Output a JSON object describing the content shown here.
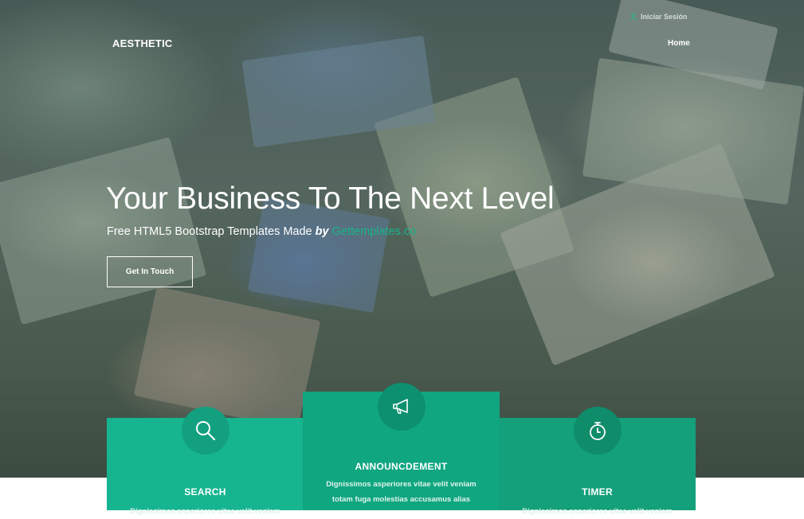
{
  "topbar": {
    "login_label": "Iniciar Sesión"
  },
  "navbar": {
    "brand": "AESTHETIC",
    "links": [
      "Home"
    ]
  },
  "hero": {
    "title": "Your Business To The Next Level",
    "subtitle_prefix": "Free HTML5 Bootstrap Templates Made",
    "subtitle_by": "by",
    "subtitle_link": "Gettemplates.co",
    "cta_label": "Get In Touch"
  },
  "features": [
    {
      "icon": "search-icon",
      "title": "SEARCH",
      "text": "Dignissimos asperiores vitae velit veniam"
    },
    {
      "icon": "megaphone-icon",
      "title": "ANNOUNCDEMENT",
      "text": "Dignissimos asperiores vitae velit veniam totam fuga molestias accusamus alias"
    },
    {
      "icon": "timer-icon",
      "title": "TIMER",
      "text": "Dignissimos asperiores vitae velit veniam"
    }
  ],
  "colors": {
    "accent": "#17b58f",
    "accent_dark": "#10a680",
    "link": "#18b48a"
  }
}
